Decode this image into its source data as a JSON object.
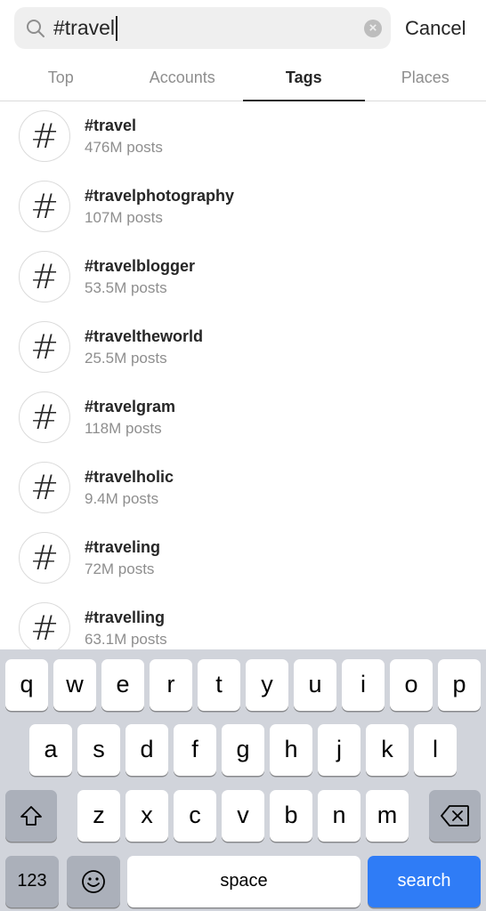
{
  "search": {
    "query": "#travel",
    "cancel_label": "Cancel"
  },
  "tabs": [
    {
      "label": "Top",
      "active": false
    },
    {
      "label": "Accounts",
      "active": false
    },
    {
      "label": "Tags",
      "active": true
    },
    {
      "label": "Places",
      "active": false
    }
  ],
  "results": [
    {
      "symbol": "#",
      "name": "#travel",
      "count": "476M posts"
    },
    {
      "symbol": "#",
      "name": "#travelphotography",
      "count": "107M posts"
    },
    {
      "symbol": "#",
      "name": "#travelblogger",
      "count": "53.5M posts"
    },
    {
      "symbol": "#",
      "name": "#traveltheworld",
      "count": "25.5M posts"
    },
    {
      "symbol": "#",
      "name": "#travelgram",
      "count": "118M posts"
    },
    {
      "symbol": "#",
      "name": "#travelholic",
      "count": "9.4M posts"
    },
    {
      "symbol": "#",
      "name": "#traveling",
      "count": "72M posts"
    },
    {
      "symbol": "#",
      "name": "#travelling",
      "count": "63.1M posts"
    }
  ],
  "keyboard": {
    "row1": [
      "q",
      "w",
      "e",
      "r",
      "t",
      "y",
      "u",
      "i",
      "o",
      "p"
    ],
    "row2": [
      "a",
      "s",
      "d",
      "f",
      "g",
      "h",
      "j",
      "k",
      "l"
    ],
    "row3": [
      "z",
      "x",
      "c",
      "v",
      "b",
      "n",
      "m"
    ],
    "numbers_label": "123",
    "space_label": "space",
    "search_label": "search"
  },
  "colors": {
    "accent_blue": "#2f7cf6",
    "muted_text": "#8e8e8e",
    "keyboard_bg": "#d1d4db"
  },
  "icons": {
    "search": "magnifier",
    "clear": "x-circle",
    "shift": "shift-arrow",
    "backspace": "delete-left",
    "emoji": "smiley"
  }
}
